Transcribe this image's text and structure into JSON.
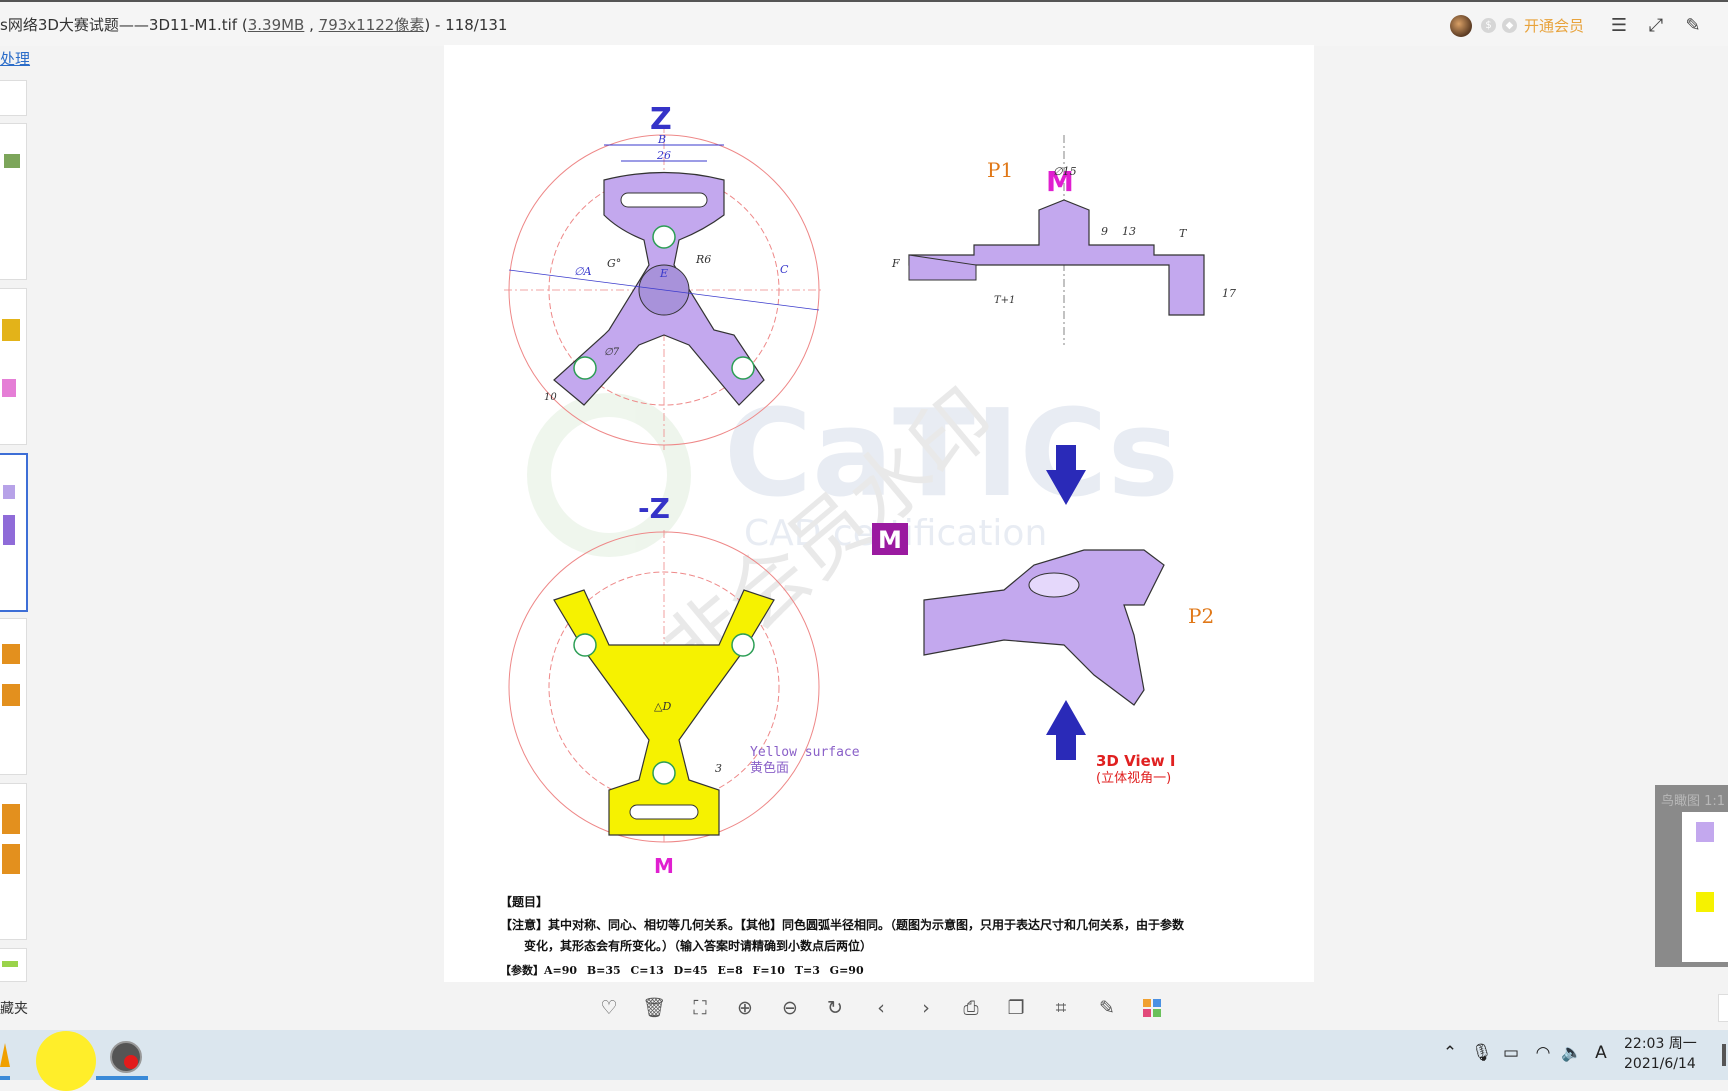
{
  "titlebar": {
    "title_prefix": "s网络3D大赛试题——3D11-M1.tif (",
    "file_size": "3.39MB",
    "sep": " , ",
    "dimensions": "793x1122像素",
    "title_suffix": ") - 118/131",
    "vip_label": "开通会员"
  },
  "sidebar": {
    "process_link": "处理",
    "favorites_label": "藏夹"
  },
  "navigator": {
    "label": "鸟瞰图 1:1"
  },
  "drawing": {
    "view_z": "Z",
    "view_neg_z": "-Z",
    "view_m": "M",
    "dim_b": "B",
    "dim_26": "26",
    "dim_r6": "R6",
    "dim_g": "G°",
    "dim_e": "E",
    "dim_c": "C",
    "dim_a": "∅A",
    "dim_7": "∅7",
    "dim_10": "10",
    "p1": "P1",
    "p2": "P2",
    "dim_15": "∅15",
    "dim_9": "9",
    "dim_13": "13",
    "dim_t": "T",
    "dim_f": "F",
    "dim_t1": "T+1",
    "dim_17": "17",
    "dim_d": "△D",
    "dim_3": "3",
    "yellow_en": "Yellow surface",
    "yellow_cn": "黄色面",
    "view3d_en": "3D View I",
    "view3d_cn": "(立体视角一)",
    "watermark": "CaTICs",
    "watermark_sub": "CAD certification",
    "watermark_cn": "非会员水印"
  },
  "problem": {
    "header": "【题目】",
    "note_line1": "【注意】其中对称、同心、相切等几何关系。【其他】同色圆弧半径相同。（题图为示意图，只用于表达尺寸和几何关系，由于参数",
    "note_line2": "变化，其形态会有所变化。）（输入答案时请精确到小数点后两位）",
    "params": "【参数】A=90 B=35 C=13 D=45 E=8 F=10 T=3 G=90"
  },
  "taskbar": {
    "time": "22:03 周一",
    "date": "2021/6/14"
  },
  "colors": {
    "accent": "#3d6ed6",
    "purple_part": "#c3a8ee",
    "yellow_face": "#f6f200",
    "dim_blue": "#3a3acc",
    "magenta": "#e01fd0",
    "vip": "#e8a33c"
  }
}
